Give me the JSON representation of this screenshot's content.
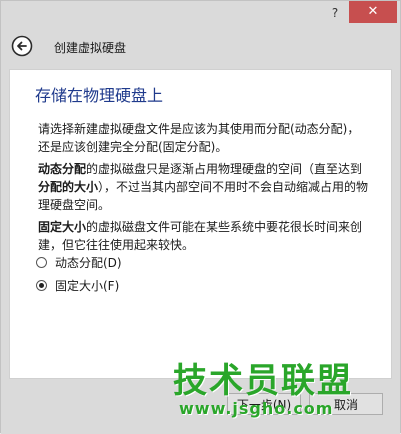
{
  "titlebar": {
    "help_label": "?",
    "close_label": "✕"
  },
  "header": {
    "title": "创建虚拟硬盘",
    "back_icon": "back-arrow-icon"
  },
  "content": {
    "page_title": "存储在物理硬盘上",
    "paragraph1": "请选择新建虚拟硬盘文件是应该为其使用而分配(动态分配)，还是应该创建完全分配(固定分配)。",
    "p2_bold1": "动态分配",
    "p2_text1": "的虚拟磁盘只是逐渐占用物理硬盘的空间（直至达到",
    "p2_bold2": "分配的大小",
    "p2_text2": "），不过当其内部空间不用时不会自动缩减占用的物理硬盘空间。",
    "p3_bold": "固定大小",
    "p3_text": "的虚拟磁盘文件可能在某些系统中要花很长时间来创建，但它往往使用起来较快。"
  },
  "options": [
    {
      "label": "动态分配(D)",
      "checked": false
    },
    {
      "label": "固定大小(F)",
      "checked": true
    }
  ],
  "footer": {
    "next_label": "下一步(N)",
    "cancel_label": "取消"
  },
  "watermark": {
    "title": "技术员联盟",
    "url": "www.jsgho.com"
  },
  "colors": {
    "title_blue": "#1f3a8c",
    "close_red": "#c74f4f",
    "watermark_green": "#2aa62a"
  }
}
